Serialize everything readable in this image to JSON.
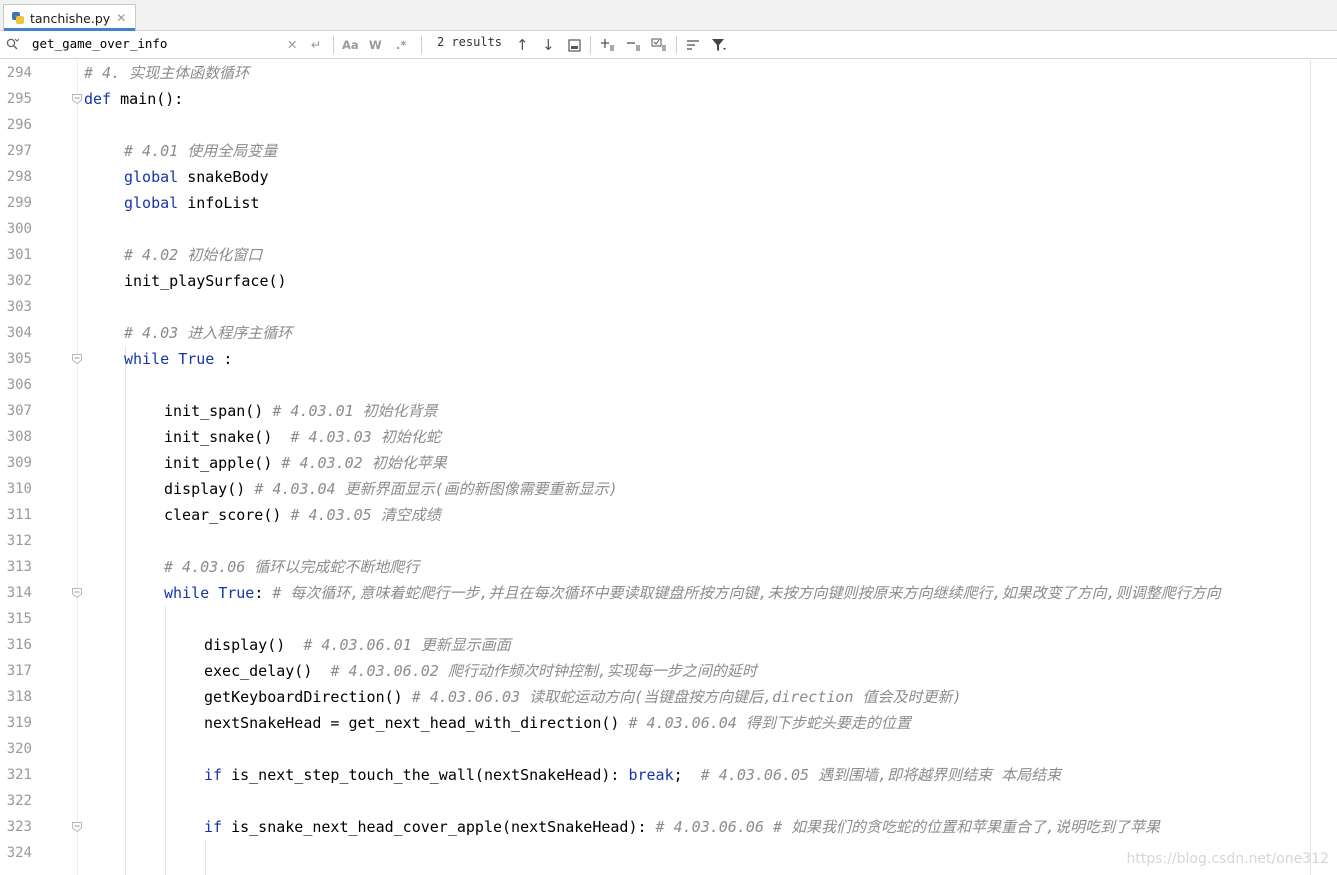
{
  "tab": {
    "filename": "tanchishe.py"
  },
  "find": {
    "query": "get_game_over_info",
    "match_case": "Aa",
    "whole_word": "W",
    "regex": ".*",
    "results": "2 results"
  },
  "editor": {
    "lines": [
      {
        "n": "294",
        "indent": 0,
        "parts": [
          [
            "cm",
            "# 4. 实现主体函数循环"
          ]
        ]
      },
      {
        "n": "295",
        "indent": 0,
        "fold": true,
        "parts": [
          [
            "kw",
            "def"
          ],
          [
            "",
            " main():"
          ]
        ]
      },
      {
        "n": "296",
        "indent": 0,
        "parts": []
      },
      {
        "n": "297",
        "indent": 1,
        "parts": [
          [
            "cm",
            "# 4.01 使用全局变量"
          ]
        ]
      },
      {
        "n": "298",
        "indent": 1,
        "parts": [
          [
            "kw",
            "global"
          ],
          [
            "",
            " snakeBody"
          ]
        ]
      },
      {
        "n": "299",
        "indent": 1,
        "parts": [
          [
            "kw",
            "global"
          ],
          [
            "",
            " infoList"
          ]
        ]
      },
      {
        "n": "300",
        "indent": 0,
        "parts": []
      },
      {
        "n": "301",
        "indent": 1,
        "parts": [
          [
            "cm",
            "# 4.02 初始化窗口"
          ]
        ]
      },
      {
        "n": "302",
        "indent": 1,
        "parts": [
          [
            "",
            "init_playSurface()"
          ]
        ]
      },
      {
        "n": "303",
        "indent": 0,
        "parts": []
      },
      {
        "n": "304",
        "indent": 1,
        "parts": [
          [
            "cm",
            "# 4.03 进入程序主循环"
          ]
        ]
      },
      {
        "n": "305",
        "indent": 1,
        "fold": true,
        "parts": [
          [
            "kw",
            "while"
          ],
          [
            "",
            " "
          ],
          [
            "kw",
            "True"
          ],
          [
            "",
            " :"
          ]
        ]
      },
      {
        "n": "306",
        "indent": 0,
        "parts": []
      },
      {
        "n": "307",
        "indent": 2,
        "parts": [
          [
            "",
            "init_span() "
          ],
          [
            "cm",
            "# 4.03.01 初始化背景"
          ]
        ]
      },
      {
        "n": "308",
        "indent": 2,
        "parts": [
          [
            "",
            "init_snake()  "
          ],
          [
            "cm",
            "# 4.03.03 初始化蛇"
          ]
        ]
      },
      {
        "n": "309",
        "indent": 2,
        "parts": [
          [
            "",
            "init_apple() "
          ],
          [
            "cm",
            "# 4.03.02 初始化苹果"
          ]
        ]
      },
      {
        "n": "310",
        "indent": 2,
        "parts": [
          [
            "",
            "display() "
          ],
          [
            "cm",
            "# 4.03.04 更新界面显示(画的新图像需要重新显示)"
          ]
        ]
      },
      {
        "n": "311",
        "indent": 2,
        "parts": [
          [
            "",
            "clear_score() "
          ],
          [
            "cm",
            "# 4.03.05 清空成绩"
          ]
        ]
      },
      {
        "n": "312",
        "indent": 0,
        "parts": []
      },
      {
        "n": "313",
        "indent": 2,
        "parts": [
          [
            "cm",
            "# 4.03.06 循环以完成蛇不断地爬行"
          ]
        ]
      },
      {
        "n": "314",
        "indent": 2,
        "fold": true,
        "parts": [
          [
            "kw",
            "while"
          ],
          [
            "",
            " "
          ],
          [
            "kw",
            "True"
          ],
          [
            "",
            ": "
          ],
          [
            "cm",
            "# 每次循环,意味着蛇爬行一步,并且在每次循环中要读取键盘所按方向键,未按方向键则按原来方向继续爬行,如果改变了方向,则调整爬行方向"
          ]
        ]
      },
      {
        "n": "315",
        "indent": 0,
        "parts": []
      },
      {
        "n": "316",
        "indent": 3,
        "parts": [
          [
            "",
            "display()  "
          ],
          [
            "cm",
            "# 4.03.06.01 更新显示画面"
          ]
        ]
      },
      {
        "n": "317",
        "indent": 3,
        "parts": [
          [
            "",
            "exec_delay()  "
          ],
          [
            "cm",
            "# 4.03.06.02 爬行动作频次时钟控制,实现每一步之间的延时"
          ]
        ]
      },
      {
        "n": "318",
        "indent": 3,
        "parts": [
          [
            "",
            "getKeyboardDirection() "
          ],
          [
            "cm",
            "# 4.03.06.03 读取蛇运动方向(当键盘按方向键后,direction 值会及时更新)"
          ]
        ]
      },
      {
        "n": "319",
        "indent": 3,
        "parts": [
          [
            "",
            "nextSnakeHead = get_next_head_with_direction() "
          ],
          [
            "cm",
            "# 4.03.06.04 得到下步蛇头要走的位置"
          ]
        ]
      },
      {
        "n": "320",
        "indent": 0,
        "parts": []
      },
      {
        "n": "321",
        "indent": 3,
        "parts": [
          [
            "kw",
            "if"
          ],
          [
            "",
            " is_next_step_touch_the_wall(nextSnakeHead): "
          ],
          [
            "kw",
            "break"
          ],
          [
            "",
            ";  "
          ],
          [
            "cm",
            "# 4.03.06.05 遇到围墙,即将越界则结束 本局结束"
          ]
        ]
      },
      {
        "n": "322",
        "indent": 0,
        "parts": []
      },
      {
        "n": "323",
        "indent": 3,
        "fold": true,
        "parts": [
          [
            "kw",
            "if"
          ],
          [
            "",
            " is_snake_next_head_cover_apple(nextSnakeHead): "
          ],
          [
            "cm",
            "# 4.03.06.06 # 如果我们的贪吃蛇的位置和苹果重合了,说明吃到了苹果"
          ]
        ]
      },
      {
        "n": "324",
        "indent": 0,
        "parts": []
      }
    ]
  },
  "watermark": "https://blog.csdn.net/one312"
}
